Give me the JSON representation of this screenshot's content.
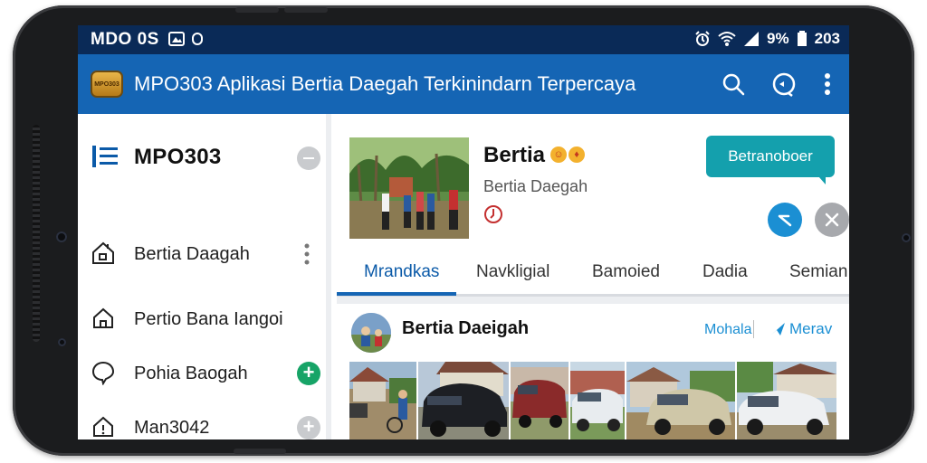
{
  "statusbar": {
    "left_text": "MDO 0S",
    "battery_percent": "9%",
    "clock": "203",
    "icons": [
      "alarm-icon",
      "wifi-icon",
      "signal-icon",
      "battery-icon"
    ]
  },
  "appbar": {
    "logo_text": "MPO303",
    "title": "MPO303  Aplikasi Bertia Daegah Terkinindarn Terpercaya",
    "icons": [
      "search-icon",
      "chat-icon",
      "more-vert-icon"
    ]
  },
  "sidebar": {
    "title": "MPO303",
    "items": [
      {
        "label": "Bertia Daagah",
        "icon": "home-icon"
      },
      {
        "label": "Pertio Bana Iangoi",
        "icon": "house-outline-icon"
      },
      {
        "label": "Pohia Baogah",
        "icon": "chat-bubble-icon"
      },
      {
        "label": "Man3042",
        "icon": "home-alert-icon"
      }
    ]
  },
  "post": {
    "title": "Bertia",
    "subtitle": "Bertia Daegah",
    "cta_label": "Betranoboer"
  },
  "tabs": [
    "Mrandkas",
    "Navkligial",
    "Bamoied",
    "Dadia",
    "Semian"
  ],
  "feed": {
    "title": "Bertia Daeigah",
    "link1": "Mohala",
    "link2": "Merav"
  },
  "colors": {
    "statusbar": "#0a2a57",
    "appbar": "#1565b4",
    "accent_teal": "#14a0ad",
    "accent_green": "#17a467",
    "accent_blue": "#1b8fd3"
  }
}
